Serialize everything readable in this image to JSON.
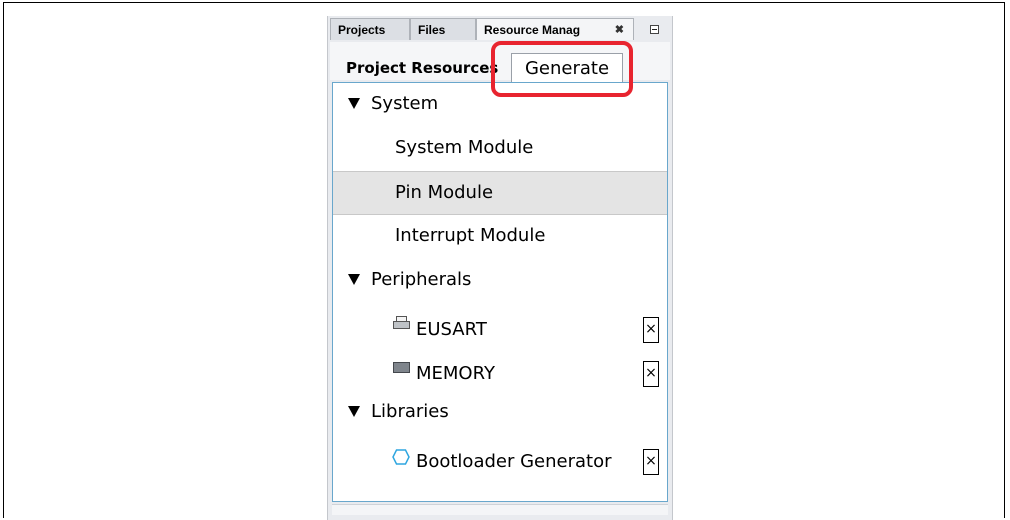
{
  "tabs": {
    "projects": "Projects",
    "files": "Files",
    "resource": "Resource Manag",
    "close_glyph": "✖"
  },
  "header": {
    "title": "Project Resources",
    "generate": "Generate"
  },
  "tree": {
    "system": {
      "label": "System",
      "items": [
        {
          "label": "System Module"
        },
        {
          "label": "Pin Module"
        },
        {
          "label": "Interrupt Module"
        }
      ]
    },
    "peripherals": {
      "label": "Peripherals",
      "items": [
        {
          "label": "EUSART",
          "icon": "printer-icon"
        },
        {
          "label": "MEMORY",
          "icon": "chip-icon"
        }
      ]
    },
    "libraries": {
      "label": "Libraries",
      "items": [
        {
          "label": "Bootloader Generator",
          "icon": "hexagon-icon"
        }
      ]
    },
    "remove_glyph": "×"
  },
  "colors": {
    "highlight": "#e8242f",
    "selected_row": "#e4e4e4",
    "tree_border": "#69a7cc"
  }
}
